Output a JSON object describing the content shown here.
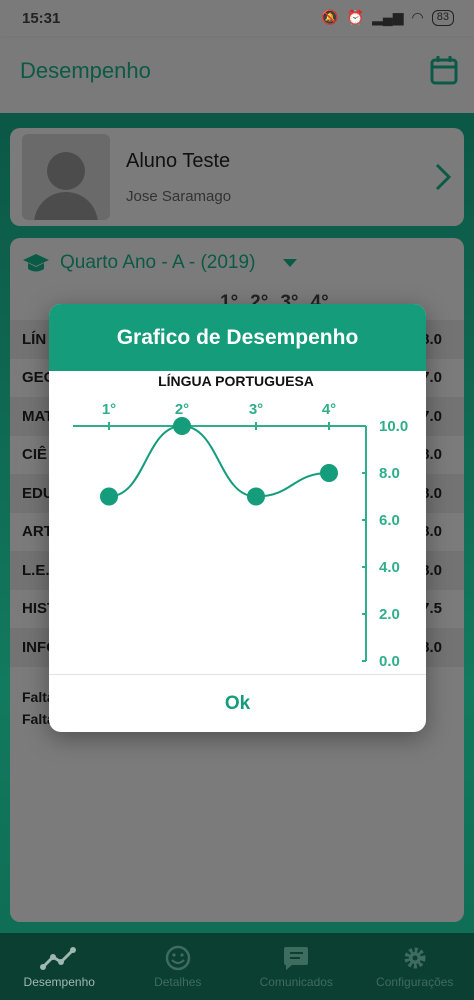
{
  "status_bar": {
    "time": "15:31",
    "battery": "83"
  },
  "app_bar": {
    "title": "Desempenho"
  },
  "student": {
    "name": "Aluno Teste",
    "subtitle": "Jose Saramago"
  },
  "class_selector": {
    "label": "Quarto Ano - A - (2019)"
  },
  "grades_table": {
    "headers": [
      "1°",
      "2°",
      "3°",
      "4°"
    ],
    "rows": [
      {
        "label": "LÍN",
        "value": "8.0"
      },
      {
        "label": "GEO",
        "value": "7.0"
      },
      {
        "label": "MAT",
        "value": "7.0"
      },
      {
        "label": "CIÊ",
        "value": "8.0"
      },
      {
        "label": "EDU",
        "value": "8.0"
      },
      {
        "label": "ART",
        "value": "8.0"
      },
      {
        "label": "L.E.",
        "value": "8.0"
      },
      {
        "label": "HIST",
        "value": "7.5"
      },
      {
        "label": "INFO",
        "value": "8.0"
      }
    ],
    "faltas": [
      "Falta",
      "Falta"
    ]
  },
  "bottom_nav": [
    {
      "label": "Desempenho",
      "icon": "chart-line-icon",
      "active": true
    },
    {
      "label": "Detalhes",
      "icon": "smiley-icon",
      "active": false
    },
    {
      "label": "Comunicados",
      "icon": "message-icon",
      "active": false
    },
    {
      "label": "Configurações",
      "icon": "gear-icon",
      "active": false
    }
  ],
  "dialog": {
    "title": "Grafico de Desempenho",
    "ok_label": "Ok"
  },
  "colors": {
    "accent": "#149c7b",
    "header": "#149c7b"
  },
  "chart_data": {
    "type": "line",
    "title": "LÍNGUA PORTUGUESA",
    "categories": [
      "1°",
      "2°",
      "3°",
      "4°"
    ],
    "values": [
      7.0,
      10.0,
      7.0,
      8.0
    ],
    "ylim": [
      0,
      10
    ],
    "yticks": [
      "0.0",
      "2.0",
      "4.0",
      "6.0",
      "8.0",
      "10.0"
    ],
    "x_axis_position": "top",
    "y_axis_position": "right",
    "grid": false,
    "line_style": "smooth"
  }
}
